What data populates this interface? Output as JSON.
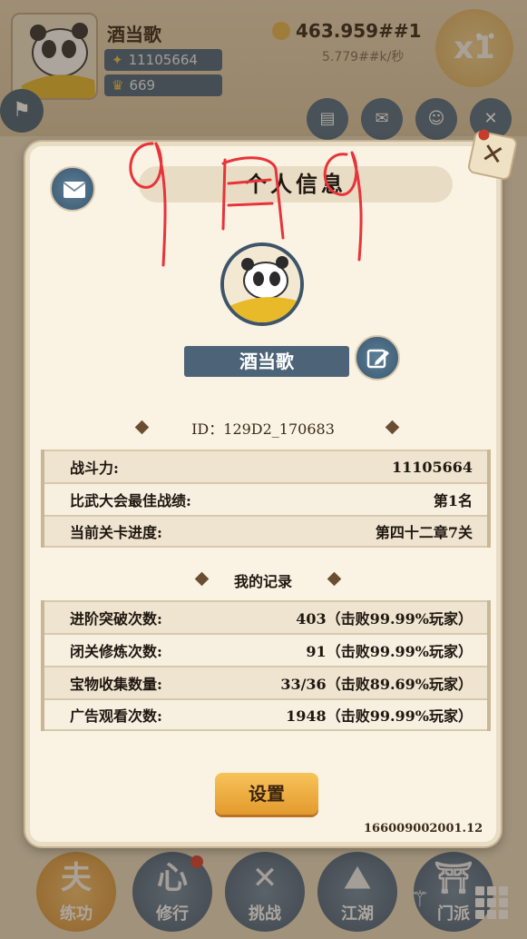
{
  "player": {
    "name": "酒当歌",
    "power": "11105664",
    "vip": "669"
  },
  "currency": {
    "amount": "463.959##1",
    "rate": "5.779##k/秒"
  },
  "top_icons": [
    "实名",
    "任务",
    "小东"
  ],
  "modal": {
    "title": "个人信息",
    "name": "酒当歌",
    "id_text": "ID：129D2_170683",
    "stats": [
      {
        "label": "战斗力:",
        "value": "11105664"
      },
      {
        "label": "比武大会最佳战绩:",
        "value": "第1名"
      },
      {
        "label": "当前关卡进度:",
        "value": "第四十二章7关"
      }
    ],
    "records_title": "我的记录",
    "records": [
      {
        "label": "进阶突破次数:",
        "value": "403（击败99.99%玩家）"
      },
      {
        "label": "闭关修炼次数:",
        "value": "91（击败99.99%玩家）"
      },
      {
        "label": "宝物收集数量:",
        "value": "33/36（击败89.69%玩家）"
      },
      {
        "label": "广告观看次数:",
        "value": "1948（击败99.99%玩家）"
      }
    ],
    "settings_label": "设置",
    "version": "166009002001.12"
  },
  "bottom_nav": [
    {
      "label": "练功",
      "glyph": "夫"
    },
    {
      "label": "修行",
      "glyph": "心"
    },
    {
      "label": "挑战",
      "glyph": "✕"
    },
    {
      "label": "江湖",
      "glyph": "⛰"
    },
    {
      "label": "门派",
      "glyph": "⛩"
    }
  ],
  "colors": {
    "accent_blue": "#4d6478",
    "gold": "#e39a2e",
    "paper": "#faf3e3"
  }
}
